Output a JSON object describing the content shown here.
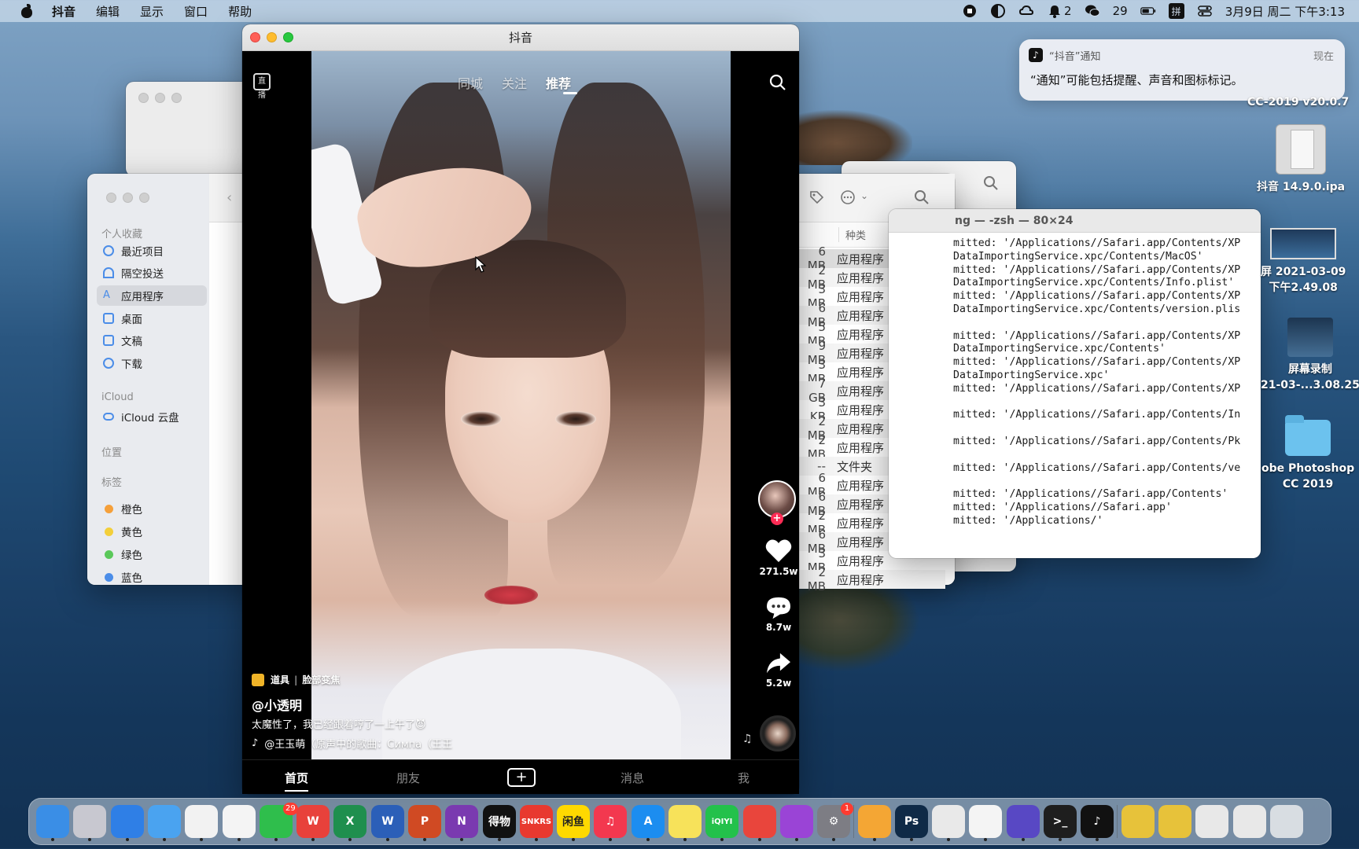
{
  "menubar": {
    "app_name": "抖音",
    "menus": [
      "编辑",
      "显示",
      "窗口",
      "帮助"
    ],
    "wechat_badge": "29",
    "notif_count": "2",
    "ime": "拼",
    "datetime": "3月9日 周二 下午3:13"
  },
  "notification": {
    "app": "“抖音”通知",
    "time": "现在",
    "body": "“通知”可能包括提醒、声音和图标标记。"
  },
  "desktop_icons": {
    "ps_cc": "CC-2019 v20.0.7",
    "ipa": "抖音 14.9.0.ipa",
    "screenshot_line1": "屏 2021-03-09",
    "screenshot_line2": "下午2.49.08",
    "recording_line1": "屏幕录制",
    "recording_line2": "21-03-...3.08.25",
    "folder_line1": "obe Photoshop",
    "folder_line2": "CC 2019"
  },
  "finder": {
    "sections": {
      "favorites": "个人收藏",
      "icloud": "iCloud",
      "locations": "位置",
      "tags": "标签"
    },
    "favorites": [
      "最近项目",
      "隔空投送",
      "应用程序",
      "桌面",
      "文稿",
      "下载"
    ],
    "selected_favorite": "应用程序",
    "icloud_items": [
      "iCloud 云盘"
    ],
    "tags": [
      {
        "label": "橙色",
        "color": "#f5a03a"
      },
      {
        "label": "黄色",
        "color": "#f3cf3a"
      },
      {
        "label": "绿色",
        "color": "#5ac85a"
      },
      {
        "label": "蓝色",
        "color": "#4b8de8"
      }
    ],
    "kind_header": "种类",
    "rows": [
      {
        "size": "6 MB",
        "kind": "应用程序"
      },
      {
        "size": "2 MB",
        "kind": "应用程序"
      },
      {
        "size": "3 MB",
        "kind": "应用程序"
      },
      {
        "size": "6 MB",
        "kind": "应用程序"
      },
      {
        "size": "5 MB",
        "kind": "应用程序"
      },
      {
        "size": "9 MB",
        "kind": "应用程序"
      },
      {
        "size": "3 MB",
        "kind": "应用程序"
      },
      {
        "size": "7 GB",
        "kind": "应用程序"
      },
      {
        "size": "3 KB",
        "kind": "应用程序"
      },
      {
        "size": "2 MB",
        "kind": "应用程序"
      },
      {
        "size": "2 MB",
        "kind": "应用程序"
      },
      {
        "size": "--",
        "kind": "文件夹"
      },
      {
        "size": "6 MB",
        "kind": "应用程序"
      },
      {
        "size": "6 MB",
        "kind": "应用程序"
      },
      {
        "size": "2 MB",
        "kind": "应用程序"
      },
      {
        "size": "6 MB",
        "kind": "应用程序"
      },
      {
        "size": "3 MB",
        "kind": "应用程序"
      },
      {
        "size": "2 MB",
        "kind": "应用程序"
      }
    ]
  },
  "terminal": {
    "title": "ng — -zsh — 80×24",
    "lines": [
      "mitted: '/Applications//Safari.app/Contents/XP",
      "DataImportingService.xpc/Contents/MacOS'",
      "mitted: '/Applications//Safari.app/Contents/XP",
      "DataImportingService.xpc/Contents/Info.plist'",
      "mitted: '/Applications//Safari.app/Contents/XP",
      "DataImportingService.xpc/Contents/version.plis",
      "",
      "mitted: '/Applications//Safari.app/Contents/XP",
      "DataImportingService.xpc/Contents'",
      "mitted: '/Applications//Safari.app/Contents/XP",
      "DataImportingService.xpc'",
      "mitted: '/Applications//Safari.app/Contents/XP",
      "",
      "mitted: '/Applications//Safari.app/Contents/In",
      "",
      "mitted: '/Applications//Safari.app/Contents/Pk",
      "",
      "mitted: '/Applications//Safari.app/Contents/ve",
      "",
      "mitted: '/Applications//Safari.app/Contents'",
      "mitted: '/Applications//Safari.app'",
      "mitted: '/Applications/'"
    ]
  },
  "douyin": {
    "window_title": "抖音",
    "live_label": "直播",
    "tabs": [
      "同城",
      "关注",
      "推荐"
    ],
    "active_tab": "推荐",
    "likes": "271.5w",
    "comments": "8.7w",
    "shares": "5.2w",
    "prop_label": "道具",
    "prop_name": "脸部变焦",
    "username": "@小透明",
    "description": "太魔性了，我已经跟着哼了一上午了😈",
    "song": "@王玉萌（原声中的歌曲：Симпа（王王",
    "bottom_nav": [
      "首页",
      "朋友",
      "消息",
      "我"
    ],
    "active_bottom": "首页"
  },
  "dock": {
    "items": [
      {
        "name": "finder",
        "label": "",
        "color": "#3a8ee6"
      },
      {
        "name": "launchpad",
        "label": "",
        "color": "#c8c8d0"
      },
      {
        "name": "safari",
        "label": "",
        "color": "#2f7fe6"
      },
      {
        "name": "mail",
        "label": "",
        "color": "#4aa3f0"
      },
      {
        "name": "photos",
        "label": "",
        "color": "#f2f2f2"
      },
      {
        "name": "qq",
        "label": "",
        "color": "#f4f4f4"
      },
      {
        "name": "wechat",
        "label": "",
        "color": "#2fbe4c"
      },
      {
        "name": "wps",
        "label": "W",
        "color": "#e8413b"
      },
      {
        "name": "excel",
        "label": "X",
        "color": "#1f8f4e"
      },
      {
        "name": "word",
        "label": "W",
        "color": "#2b5fb8"
      },
      {
        "name": "powerpoint",
        "label": "P",
        "color": "#d04a23"
      },
      {
        "name": "onenote",
        "label": "N",
        "color": "#7a3ab0"
      },
      {
        "name": "dewu",
        "label": "得物",
        "color": "#111111"
      },
      {
        "name": "snkrs",
        "label": "SNKRS",
        "color": "#e8392f"
      },
      {
        "name": "xianyu",
        "label": "闲鱼",
        "color": "#ffd900"
      },
      {
        "name": "music",
        "label": "♫",
        "color": "#f3384f"
      },
      {
        "name": "app-store",
        "label": "A",
        "color": "#1c8df0"
      },
      {
        "name": "notes",
        "label": "",
        "color": "#f7e25a"
      },
      {
        "name": "iqiyi",
        "label": "iQIYI",
        "color": "#23c14b"
      },
      {
        "name": "bear",
        "label": "",
        "color": "#e9453c"
      },
      {
        "name": "podcasts",
        "label": "",
        "color": "#9a44d6"
      },
      {
        "name": "system-preferences",
        "label": "⚙",
        "color": "#7d7d84"
      },
      {
        "name": "pages",
        "label": "",
        "color": "#f4a634"
      },
      {
        "name": "photoshop",
        "label": "Ps",
        "color": "#0f2a47"
      },
      {
        "name": "chrome",
        "label": "",
        "color": "#e9e9e9"
      },
      {
        "name": "qq2",
        "label": "",
        "color": "#f4f4f4"
      },
      {
        "name": "disk-utility",
        "label": "",
        "color": "#5848c4"
      },
      {
        "name": "terminal",
        "label": ">_",
        "color": "#1e1e1e"
      },
      {
        "name": "douyin",
        "label": "♪",
        "color": "#111111"
      },
      {
        "name": "pkg-1",
        "label": "",
        "color": "#e7c23a"
      },
      {
        "name": "pkg-2",
        "label": "",
        "color": "#e7c23a"
      },
      {
        "name": "preview-1",
        "label": "",
        "color": "#e8e8e8"
      },
      {
        "name": "preview-2",
        "label": "",
        "color": "#e8e8e8"
      },
      {
        "name": "trash",
        "label": "",
        "color": "#d8dde2"
      }
    ],
    "badges": {
      "wechat": "29",
      "system-preferences": "1"
    }
  }
}
